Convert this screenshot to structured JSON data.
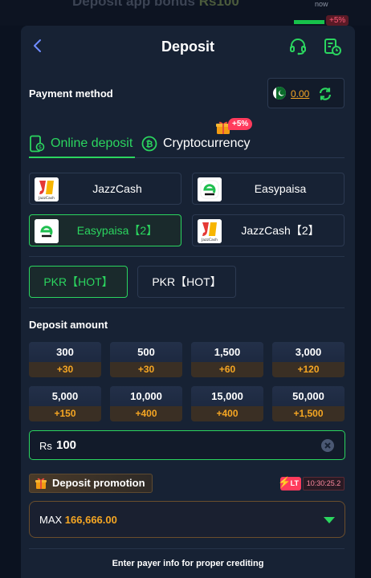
{
  "top_strip": {
    "faded_text": "Deposit app bonus",
    "faded_amount": "Rs100",
    "now": "now",
    "percent": "+5%"
  },
  "header": {
    "title": "Deposit"
  },
  "payment_method": {
    "label": "Payment method",
    "balance": "0.00"
  },
  "tabs": [
    {
      "label": "Online deposit",
      "active": true
    },
    {
      "label": "Cryptocurrency",
      "badge": "+5%"
    }
  ],
  "methods": [
    {
      "label": "JazzCash",
      "logo": "jazzcash-logo",
      "selected": false
    },
    {
      "label": "Easypaisa",
      "logo": "easypaisa-logo",
      "selected": false
    },
    {
      "label": "Easypaisa【2】",
      "logo": "easypaisa-logo",
      "selected": true
    },
    {
      "label": "JazzCash【2】",
      "logo": "jazzcash-logo",
      "selected": false
    }
  ],
  "logo_text": "JazzCash",
  "currencies": [
    {
      "label": "PKR【HOT】",
      "selected": true
    },
    {
      "label": "PKR【HOT】",
      "selected": false
    }
  ],
  "deposit_amount": {
    "label": "Deposit amount",
    "options": [
      {
        "amount": "300",
        "bonus": "+30"
      },
      {
        "amount": "500",
        "bonus": "+30"
      },
      {
        "amount": "1,500",
        "bonus": "+60"
      },
      {
        "amount": "3,000",
        "bonus": "+120"
      },
      {
        "amount": "5,000",
        "bonus": "+150"
      },
      {
        "amount": "10,000",
        "bonus": "+400"
      },
      {
        "amount": "15,000",
        "bonus": "+400"
      },
      {
        "amount": "50,000",
        "bonus": "+1,500"
      }
    ],
    "currency_symbol": "Rs",
    "value": "100"
  },
  "promotion": {
    "label": "Deposit promotion",
    "lt_badge": "LT",
    "timer": "10:30:25.2",
    "select_prefix": "MAX",
    "select_value": "166,666.00"
  },
  "footer_note": "Enter payer info for proper crediting",
  "colors": {
    "accent_green": "#2bd55f",
    "bonus_orange": "#f5a623",
    "panel": "#172234",
    "badge_red": "#ff3b5c"
  }
}
